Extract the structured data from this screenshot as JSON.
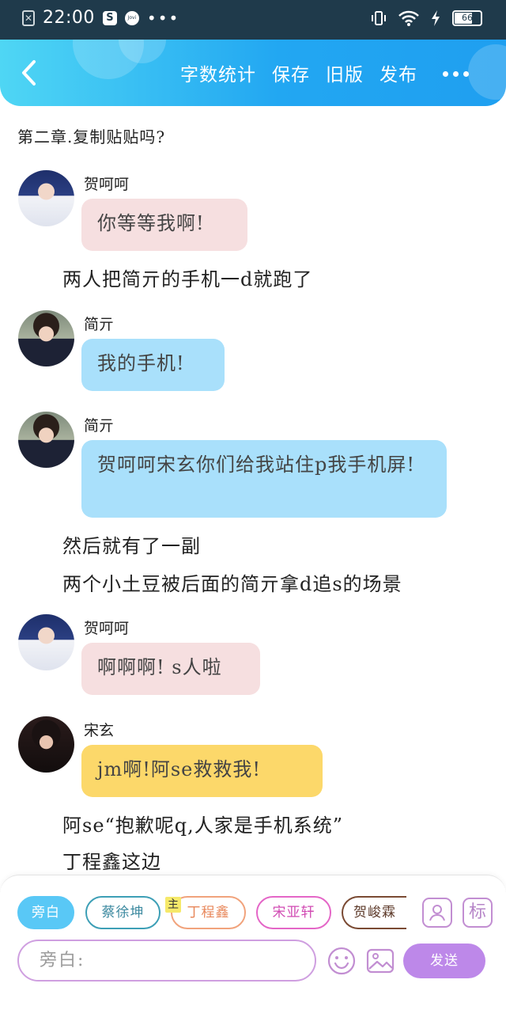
{
  "status_bar": {
    "time": "22:00",
    "battery": "66",
    "app_badge_s": "S",
    "app_badge_vivo": "Jovi",
    "dots": "•••"
  },
  "header": {
    "actions": [
      "字数统计",
      "保存",
      "旧版",
      "发布"
    ]
  },
  "chapter_title": "第二章.复制贴贴吗?",
  "messages": [
    {
      "name": "贺呵呵",
      "text": "你等等我啊!"
    },
    {
      "narration": "两人把简亓的手机一d就跑了"
    },
    {
      "name": "简亓",
      "text": "我的手机!"
    },
    {
      "name": "简亓",
      "text": "贺呵呵宋玄你们给我站住p我手机屏!"
    },
    {
      "narration": "然后就有了一副"
    },
    {
      "narration": "两个小土豆被后面的简亓拿d追s的场景"
    },
    {
      "name": "贺呵呵",
      "text": "啊啊啊! s人啦"
    },
    {
      "name": "宋玄",
      "text": "jm啊!阿se救救我!"
    },
    {
      "narration": "阿se“抱歉呢q,人家是手机系统”"
    },
    {
      "narration": "丁程鑫这边"
    }
  ],
  "composer": {
    "chips": [
      "旁白",
      "蔡徐坤",
      "丁程鑫",
      "宋亚轩",
      "贺峻霖"
    ],
    "main_badge": "主",
    "tag_button": "标",
    "input_placeholder": "旁白:",
    "send_label": "发送"
  },
  "colors": {
    "header_gradient_start": "#4fd6f4",
    "header_gradient_end": "#1f9ff0",
    "bubble_pink": "#f6dfe0",
    "bubble_blue": "#a9e0fb",
    "bubble_yellow": "#fcd86a",
    "send_button": "#bd88e9"
  }
}
